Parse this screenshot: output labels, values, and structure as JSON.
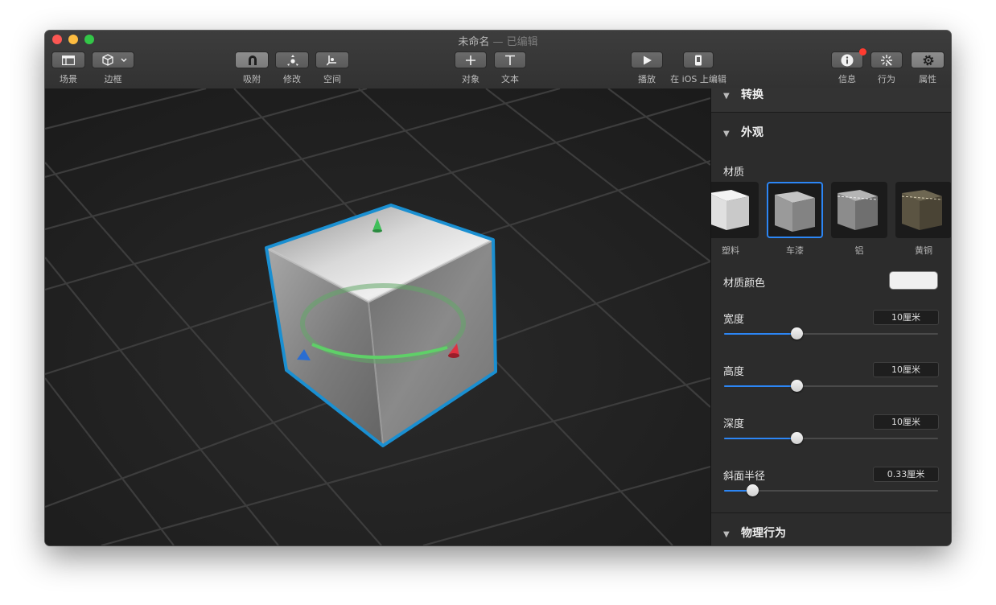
{
  "window": {
    "title": "未命名",
    "title_suffix": " — 已编辑"
  },
  "toolbar": {
    "scene": "场景",
    "bounds": "边框",
    "snap": "吸附",
    "modify": "修改",
    "space": "空间",
    "object": "对象",
    "text": "文本",
    "play": "播放",
    "edit_on_ios": "在 iOS 上编辑",
    "info": "信息",
    "behaviors": "行为",
    "properties": "属性"
  },
  "inspector": {
    "transform_title": "转换",
    "appearance_title": "外观",
    "material_label": "材质",
    "materials": [
      {
        "name": "塑料",
        "selected": false,
        "color": "#d9d9d9"
      },
      {
        "name": "车漆",
        "selected": true,
        "color": "#9a9a9a"
      },
      {
        "name": "铝",
        "selected": false,
        "color": "#8c8c8c"
      },
      {
        "name": "黄铜",
        "selected": false,
        "color": "#5b5442"
      }
    ],
    "material_color_label": "材质颜色",
    "material_color": "#f0f0f0",
    "width_label": "宽度",
    "width_value": "10厘米",
    "width_level": 0.33,
    "height_label": "高度",
    "height_value": "10厘米",
    "height_level": 0.33,
    "depth_label": "深度",
    "depth_value": "10厘米",
    "depth_level": 0.33,
    "bevel_label": "斜面半径",
    "bevel_value": "0.33厘米",
    "bevel_level": 0.11,
    "physics_title": "物理行为"
  },
  "colors": {
    "accent": "#2c86f5",
    "selection_outline": "#1a8fd1"
  }
}
